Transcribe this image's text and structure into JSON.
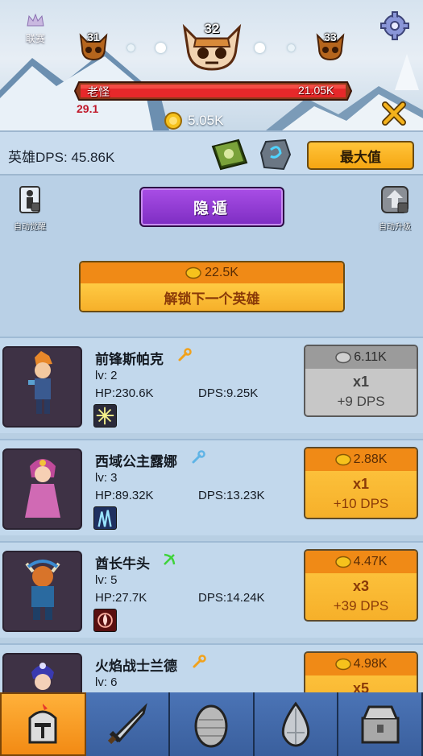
{
  "top": {
    "league_label": "联赛",
    "stages": {
      "prev": "31",
      "current": "32",
      "next": "33"
    },
    "enemy": {
      "name": "老怪",
      "hp": "21.05K",
      "hp_fraction": 1.0,
      "damage": "29.1"
    },
    "gold": "5.05K"
  },
  "dps": {
    "label": "英雄DPS: 45.86K",
    "max_button": "最大值"
  },
  "panel": {
    "auto_left_label": "自动觉醒",
    "auto_right_label": "自动升级",
    "hide_button": "隐遁",
    "unlock": {
      "cost": "22.5K",
      "label": "解锁下一个英雄"
    }
  },
  "heroes": [
    {
      "name": "前锋斯帕克",
      "lv": "lv: 2",
      "hp": "HP:230.6K",
      "dps": "DPS:9.25K",
      "cost": "6.11K",
      "mult": "x1",
      "gain": "+9 DPS",
      "affordable": false
    },
    {
      "name": "西域公主露娜",
      "lv": "lv: 3",
      "hp": "HP:89.32K",
      "dps": "DPS:13.23K",
      "cost": "2.88K",
      "mult": "x1",
      "gain": "+10 DPS",
      "affordable": true
    },
    {
      "name": "酋长牛头",
      "lv": "lv: 5",
      "hp": "HP:27.7K",
      "dps": "DPS:14.24K",
      "cost": "4.47K",
      "mult": "x3",
      "gain": "+39 DPS",
      "affordable": true
    },
    {
      "name": "火焰战士兰德",
      "lv": "lv: 6",
      "hp": "",
      "dps": "",
      "cost": "4.98K",
      "mult": "x5",
      "gain": "",
      "affordable": true
    }
  ],
  "nav": [
    "heroes-tab",
    "weapons-tab",
    "egg-tab",
    "gem-tab",
    "chest-tab"
  ]
}
